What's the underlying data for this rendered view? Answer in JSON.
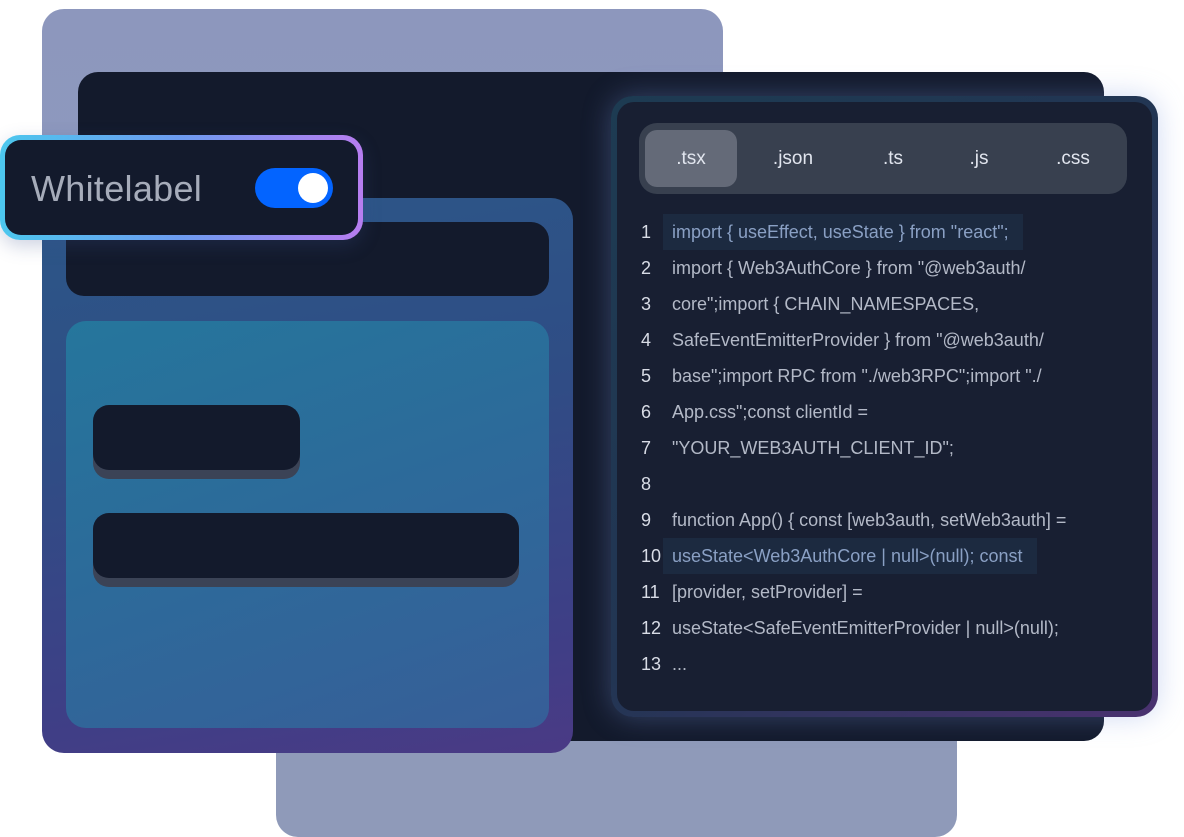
{
  "whitelabel": {
    "label": "Whitelabel",
    "toggle_on": true,
    "toggle_color": "#0364ff"
  },
  "code_editor": {
    "tabs": [
      {
        "label": ".tsx",
        "active": true
      },
      {
        "label": ".json",
        "active": false
      },
      {
        "label": ".ts",
        "active": false
      },
      {
        "label": ".js",
        "active": false
      },
      {
        "label": ".css",
        "active": false
      }
    ],
    "lines": [
      {
        "num": "1",
        "text": "import { useEffect, useState } from \"react\";",
        "highlighted": true
      },
      {
        "num": "2",
        "text": "import { Web3AuthCore } from \"@web3auth/",
        "highlighted": false
      },
      {
        "num": "3",
        "text": "core\";import { CHAIN_NAMESPACES,",
        "highlighted": false
      },
      {
        "num": "4",
        "text": "SafeEventEmitterProvider } from \"@web3auth/",
        "highlighted": false
      },
      {
        "num": "5",
        "text": "base\";import RPC from \"./web3RPC\";import \"./",
        "highlighted": false
      },
      {
        "num": "6",
        "text": "App.css\";const clientId =",
        "highlighted": false
      },
      {
        "num": "7",
        "text": "\"YOUR_WEB3AUTH_CLIENT_ID\";",
        "highlighted": false
      },
      {
        "num": "8",
        "text": "",
        "highlighted": false
      },
      {
        "num": "9",
        "text": "function App() {  const [web3auth, setWeb3auth] =",
        "highlighted": false
      },
      {
        "num": "10",
        "text": "useState<Web3AuthCore | null>(null);  const",
        "highlighted": true
      },
      {
        "num": "11",
        "text": "[provider, setProvider] =",
        "highlighted": false
      },
      {
        "num": "12",
        "text": "useState<SafeEventEmitterProvider | null>(null);",
        "highlighted": false
      },
      {
        "num": "13",
        "text": "...",
        "highlighted": false
      }
    ]
  },
  "colors": {
    "window_bg": "#131a2c",
    "accent_blue": "#0364ff",
    "gradient_cyan": "#4cc7ee",
    "gradient_purple": "#b77df0"
  }
}
